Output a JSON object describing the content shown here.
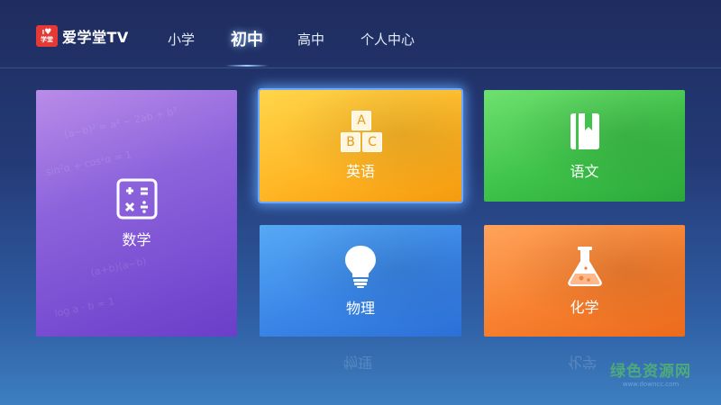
{
  "app": {
    "logo_badge_top": "I",
    "logo_badge_bottom": "学堂",
    "logo_text": "爱学堂TV"
  },
  "nav": {
    "items": [
      {
        "label": "小学",
        "active": false
      },
      {
        "label": "初中",
        "active": true
      },
      {
        "label": "高中",
        "active": false
      },
      {
        "label": "个人中心",
        "active": false
      }
    ]
  },
  "tiles": {
    "math": {
      "label": "数学",
      "color": "#8d63dc",
      "icon": "calculator-icon"
    },
    "english": {
      "label": "英语",
      "color": "#ffb726",
      "icon": "abc-blocks-icon",
      "blocks": [
        "A",
        "B",
        "C"
      ],
      "focused": true
    },
    "chinese": {
      "label": "语文",
      "color": "#3fc34a",
      "icon": "book-icon"
    },
    "physics": {
      "label": "物理",
      "color": "#3a86e8",
      "icon": "lightbulb-icon"
    },
    "chemistry": {
      "label": "化学",
      "color": "#f7802f",
      "icon": "flask-icon"
    }
  },
  "watermark": {
    "text": "绿色资源网",
    "url": "www.downcc.com"
  }
}
